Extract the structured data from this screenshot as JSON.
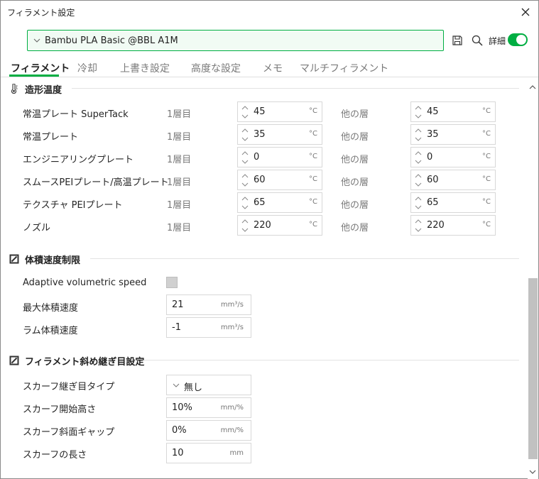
{
  "window": {
    "title": "フィラメント設定"
  },
  "header": {
    "preset": "Bambu PLA Basic @BBL A1M",
    "detail_label": "詳細",
    "detail_toggle_on": true,
    "accent_color": "#00ae42",
    "icons": [
      "save-icon",
      "search-icon"
    ]
  },
  "tabs": [
    {
      "label": "フィラメント",
      "active": true
    },
    {
      "label": "冷却",
      "active": false
    },
    {
      "label": "上書き設定",
      "active": false
    },
    {
      "label": "高度な設定",
      "active": false
    },
    {
      "label": "メモ",
      "active": false
    },
    {
      "label": "マルチフィラメント",
      "active": false
    }
  ],
  "temp_section": {
    "title": "造形温度",
    "first_layer": "1層目",
    "other_layers": "他の層",
    "unit": "°C",
    "rows": [
      {
        "label": "常温プレート SuperTack",
        "first": "45",
        "other": "45"
      },
      {
        "label": "常温プレート",
        "first": "35",
        "other": "35"
      },
      {
        "label": "エンジニアリングプレート",
        "first": "0",
        "other": "0"
      },
      {
        "label": "スムースPEIプレート/高温プレート",
        "first": "60",
        "other": "60"
      },
      {
        "label": "テクスチャ PEIプレート",
        "first": "65",
        "other": "65"
      },
      {
        "label": "ノズル",
        "first": "220",
        "other": "220"
      }
    ]
  },
  "volume_section": {
    "title": "体積速度制限",
    "adaptive_label": "Adaptive volumetric speed",
    "adaptive_checked": false,
    "max_label": "最大体積速度",
    "max_value": "21",
    "max_unit": "mm³/s",
    "ramming_label": "ラム体積速度",
    "ramming_value": "-1",
    "ramming_unit": "mm³/s"
  },
  "scarf_section": {
    "title": "フィラメント斜め継ぎ目設定",
    "type_label": "スカーフ継ぎ目タイプ",
    "type_value": "無し",
    "start_height_label": "スカーフ開始高さ",
    "start_height_value": "10%",
    "start_height_unit": "mm/%",
    "slope_gap_label": "スカーフ斜面ギャップ",
    "slope_gap_value": "0%",
    "slope_gap_unit": "mm/%",
    "length_label": "スカーフの長さ",
    "length_value": "10",
    "length_unit": "mm"
  }
}
